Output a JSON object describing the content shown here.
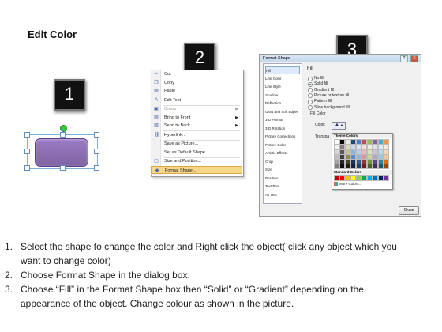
{
  "title": "Edit Color",
  "step_numbers": [
    "1",
    "2",
    "3"
  ],
  "context_menu": {
    "items": [
      {
        "label": "Cut",
        "icon": "cut-icon",
        "disabled": false,
        "arrow": false
      },
      {
        "label": "Copy",
        "icon": "copy-icon",
        "disabled": false,
        "arrow": false
      },
      {
        "label": "Paste",
        "icon": "paste-icon",
        "disabled": false,
        "arrow": false
      },
      {
        "label": "Edit Text",
        "icon": "edit-text-icon",
        "disabled": false,
        "arrow": false
      },
      {
        "label": "Group",
        "icon": "group-icon",
        "disabled": true,
        "arrow": true
      },
      {
        "label": "Bring to Front",
        "icon": "bring-front-icon",
        "disabled": false,
        "arrow": true
      },
      {
        "label": "Send to Back",
        "icon": "send-back-icon",
        "disabled": false,
        "arrow": true
      },
      {
        "label": "Hyperlink...",
        "icon": "hyperlink-icon",
        "disabled": false,
        "arrow": false
      },
      {
        "label": "Save as Picture...",
        "icon": "",
        "disabled": false,
        "arrow": false
      },
      {
        "label": "Set as Default Shape",
        "icon": "",
        "disabled": false,
        "arrow": false
      },
      {
        "label": "Size and Position...",
        "icon": "size-icon",
        "disabled": false,
        "arrow": false
      },
      {
        "label": "Format Shape...",
        "icon": "format-shape-icon",
        "disabled": false,
        "arrow": false,
        "highlighted": true
      }
    ]
  },
  "dialog": {
    "title": "Format Shape",
    "title_buttons": [
      "?",
      "X"
    ],
    "categories": [
      "Fill",
      "Line Color",
      "Line Style",
      "Shadow",
      "Reflection",
      "Glow and Soft Edges",
      "3-D Format",
      "3-D Rotation",
      "Picture Corrections",
      "Picture Color",
      "Artistic Effects",
      "Crop",
      "Size",
      "Position",
      "Text Box",
      "Alt Text"
    ],
    "selected_category": "Fill",
    "panel_heading": "Fill",
    "fill_options": [
      {
        "label": "No fill",
        "selected": false
      },
      {
        "label": "Solid fill",
        "selected": true
      },
      {
        "label": "Gradient fill",
        "selected": false
      },
      {
        "label": "Picture or texture fill",
        "selected": false
      },
      {
        "label": "Pattern fill",
        "selected": false
      },
      {
        "label": "Slide background fill",
        "selected": false
      }
    ],
    "fill_color_label": "Fill Color",
    "color_label": "Color:",
    "transparency_label": "Transpa",
    "palette": {
      "theme_heading": "Theme Colors",
      "standard_heading": "Standard Colors",
      "more_colors": "More Colors...",
      "theme_top_row": [
        "#ffffff",
        "#000000",
        "#eeece1",
        "#1f497d",
        "#4f81bd",
        "#c0504d",
        "#9bbb59",
        "#8064a2",
        "#4bacc6",
        "#f79646"
      ],
      "theme_shades": [
        [
          "#f2f2f2",
          "#7f7f7f",
          "#ddd9c3",
          "#c6d9f0",
          "#dbe5f1",
          "#f2dcdb",
          "#ebf1dd",
          "#e5e0ec",
          "#dbeef3",
          "#fdeada"
        ],
        [
          "#d8d8d8",
          "#595959",
          "#c4bd97",
          "#8db3e2",
          "#b8cce4",
          "#e5b9b7",
          "#d7e3bc",
          "#ccc1d9",
          "#b7dde8",
          "#fbd5b5"
        ],
        [
          "#bfbfbf",
          "#3f3f3f",
          "#938953",
          "#548dd4",
          "#95b3d7",
          "#d99694",
          "#c3d69b",
          "#b2a2c7",
          "#92cddc",
          "#fac08f"
        ],
        [
          "#a5a5a5",
          "#262626",
          "#494429",
          "#17365d",
          "#366092",
          "#953734",
          "#76923c",
          "#5f497a",
          "#31859b",
          "#e36c09"
        ],
        [
          "#7f7f7f",
          "#0c0c0c",
          "#1d1b10",
          "#0f243e",
          "#244061",
          "#632423",
          "#4f6128",
          "#3f3151",
          "#205867",
          "#974806"
        ]
      ],
      "standard_row": [
        "#c00000",
        "#ff0000",
        "#ffc000",
        "#ffff00",
        "#92d050",
        "#00b050",
        "#00b0f0",
        "#0070c0",
        "#002060",
        "#7030a0"
      ]
    },
    "close_label": "Close"
  },
  "shape_color": "#8064a2",
  "instructions": [
    {
      "num": "1.",
      "lines": [
        "Select the shape to change the color and Right click the object( click any object which you",
        "want to change color)"
      ]
    },
    {
      "num": "2.",
      "lines": [
        "Choose Format Shape in the dialog box."
      ]
    },
    {
      "num": "3.",
      "lines": [
        "Choose “Fill” in the Format Shape box then “Solid” or “Gradient” depending on the",
        "appearance of the object. Change colour as shown in the picture."
      ]
    }
  ]
}
